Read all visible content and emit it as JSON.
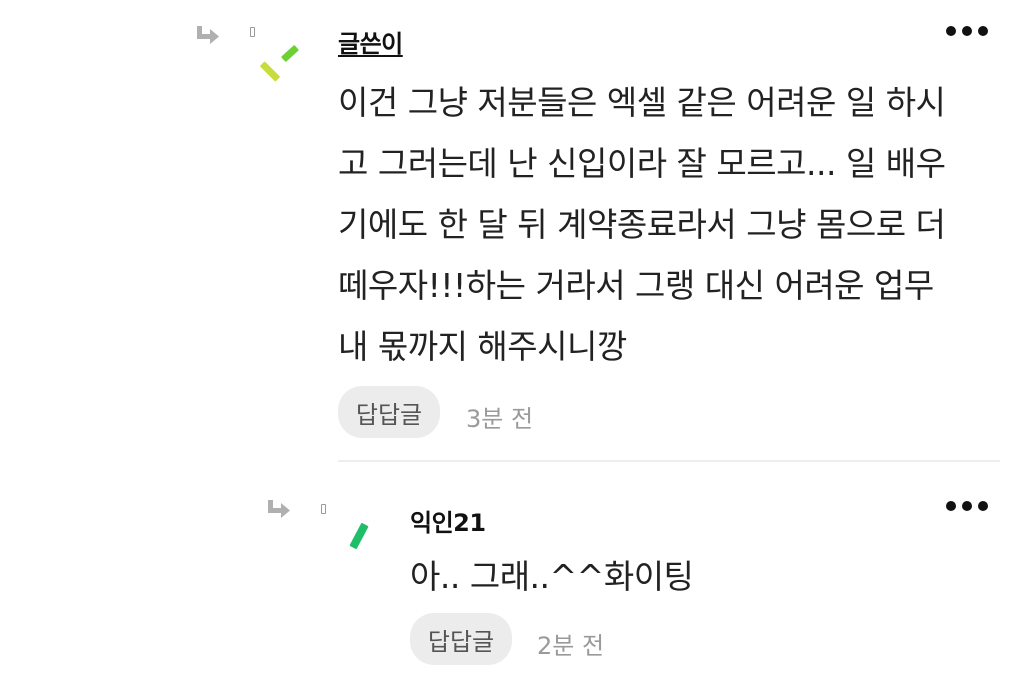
{
  "comments": [
    {
      "author": "글쓴이",
      "body": "이건 그냥 저분들은 엑셀 같은 어려운 일 하시\n고 그러는데 난 신입이라 잘 모르고... 일 배우\n기에도 한 달 뒤 계약종료라서 그냥 몸으로 더\n떼우자!!!하는 거라서 그랭 대신 어려운 업무\n내 몫까지 해주시니깡",
      "reply_label": "답답글",
      "time": "3분 전"
    },
    {
      "author": "익인21",
      "body": "아.. 그래..^^화이팅",
      "reply_label": "답답글",
      "time": "2분 전"
    }
  ],
  "icons": {
    "reply": "reply-arrow-icon",
    "lock": "lock-icon",
    "more": "more-dots-icon"
  },
  "colors": {
    "avatar_lime": "#c8dc3c",
    "avatar_green": "#6fd034",
    "avatar_emerald": "#1fbf6a"
  }
}
